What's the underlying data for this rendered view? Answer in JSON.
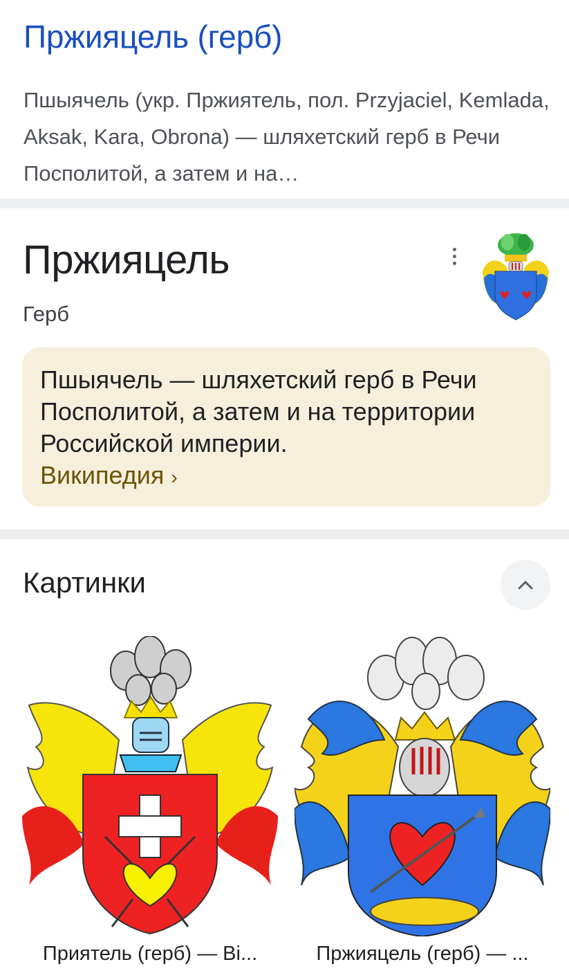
{
  "search_result": {
    "title": "Пржияцель (герб)",
    "snippet": "Пшыячель (укр. Пржиятель, пол. Przyjaciel, Kemlada, Aksak, Kara, Obrona) — шляхетский герб в Речи Посполитой, а затем и на…"
  },
  "knowledge_panel": {
    "title": "Пржияцель",
    "subtitle": "Герб",
    "menu_icon": "more-vert-icon",
    "thumbnail_icon": "coat-of-arms-thumbnail",
    "description": "Пшыячель — шляхетский герб в Речи Посполитой, а затем и на территории Российской империи.",
    "source_link": "Википедия",
    "source_chevron": "›",
    "colors": {
      "description_bg": "#f6efdc",
      "link": "#6b5400"
    }
  },
  "images_section": {
    "heading": "Картинки",
    "collapse_icon": "chevron-up-icon",
    "items": [
      {
        "caption": "Приятель (герб) — Ві...",
        "image": "red-shield-coat-of-arms"
      },
      {
        "caption": "Пржияцель (герб) — ...",
        "image": "blue-shield-coat-of-arms"
      }
    ]
  },
  "colors": {
    "title_link": "#1a4fbf",
    "divider": "#eceef0"
  }
}
